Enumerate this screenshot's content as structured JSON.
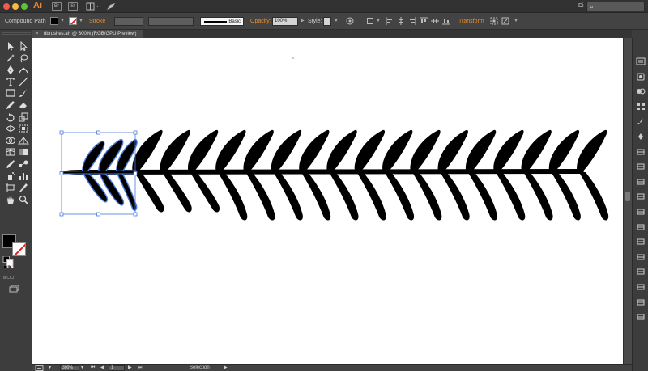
{
  "appbar": {
    "logo": "Ai",
    "bridge_label": "Br",
    "stock_label": "St",
    "workspace_label": "Di",
    "search_placeholder": ""
  },
  "controlbar": {
    "selection_type": "Compound Path",
    "stroke_label": "Stroke",
    "brush_label": "Basic",
    "opacity_label": "Opacity:",
    "opacity_value": "100%",
    "style_label": "Style:",
    "transform_label": "Transform"
  },
  "document_tab": {
    "close": "×",
    "title": "dbrushes.ai* @ 300% (RGB/GPU Preview)"
  },
  "statusbar": {
    "zoom": "300%",
    "artboard": "1",
    "tool": "Selection"
  },
  "colors": {
    "accent": "#e98e2a",
    "selection": "#4a7bd9",
    "fill": "#000000",
    "stroke": "none"
  },
  "icons": {
    "left_tools": [
      "selection-icon",
      "direct-selection-icon",
      "magic-wand-icon",
      "lasso-icon",
      "pen-icon",
      "curvature-icon",
      "type-icon",
      "line-icon",
      "rectangle-icon",
      "paintbrush-icon",
      "pencil-icon",
      "eraser-icon",
      "rotate-icon",
      "scale-icon",
      "width-icon",
      "free-transform-icon",
      "shape-builder-icon",
      "perspective-icon",
      "mesh-icon",
      "gradient-icon",
      "eyedropper-icon",
      "blend-icon",
      "symbol-sprayer-icon",
      "graph-icon",
      "artboard-icon",
      "slice-icon",
      "hand-icon",
      "zoom-icon"
    ],
    "right_panels": [
      "properties-icon",
      "libraries-icon",
      "color-icon",
      "swatches-icon",
      "brushes-icon",
      "symbols-icon",
      "stroke-icon",
      "gradient-icon",
      "transparency-icon",
      "appearance-icon",
      "graphic-styles-icon",
      "layers-icon",
      "artboards-icon",
      "asset-export-icon",
      "align-icon",
      "transform-icon",
      "pathfinder-icon",
      "links-icon"
    ]
  }
}
